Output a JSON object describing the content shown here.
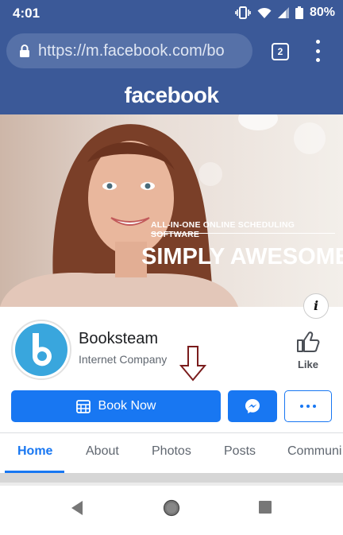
{
  "status": {
    "time": "4:01",
    "battery": "80%"
  },
  "browser": {
    "url": "https://m.facebook.com/bo",
    "tab_count": "2"
  },
  "header": {
    "logo": "facebook"
  },
  "cover": {
    "subtitle": "ALL-IN-ONE ONLINE SCHEDULING SOFTWARE",
    "headline": "SIMPLY AWESOME"
  },
  "page": {
    "name": "Booksteam",
    "category": "Internet Company",
    "avatar_letter": "b"
  },
  "actions": {
    "like_label": "Like",
    "book_label": "Book Now"
  },
  "tabs": [
    {
      "label": "Home"
    },
    {
      "label": "About"
    },
    {
      "label": "Photos"
    },
    {
      "label": "Posts"
    },
    {
      "label": "Communi"
    }
  ],
  "colors": {
    "brand": "#3b5998",
    "accent": "#1877f2",
    "arrow": "#7a1c1c"
  }
}
